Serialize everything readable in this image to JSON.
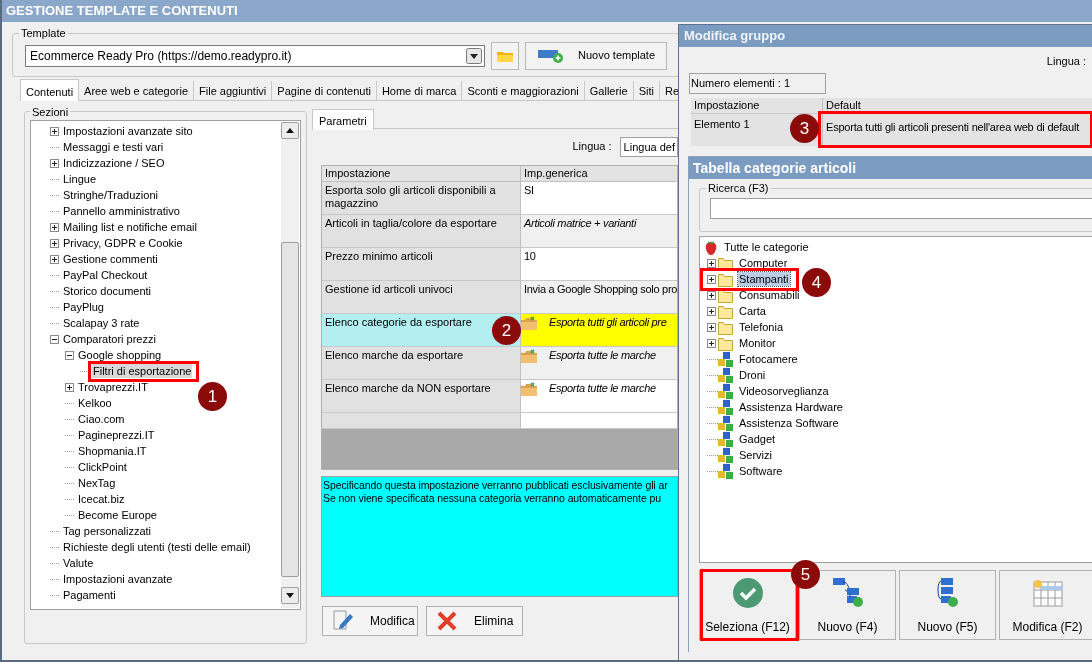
{
  "window": {
    "title": "GESTIONE TEMPLATE E CONTENUTI"
  },
  "template": {
    "label": "Template",
    "value": "Ecommerce Ready Pro (https://demo.readypro.it)",
    "new_button": "Nuovo template"
  },
  "tabs": [
    {
      "label": "Contenuti",
      "selected": true
    },
    {
      "label": "Aree web e categorie",
      "selected": false
    },
    {
      "label": "File aggiuntivi",
      "selected": false
    },
    {
      "label": "Pagine di contenuti",
      "selected": false
    },
    {
      "label": "Home di marca",
      "selected": false
    },
    {
      "label": "Sconti e maggiorazioni",
      "selected": false
    },
    {
      "label": "Gallerie",
      "selected": false
    },
    {
      "label": "Siti",
      "selected": false
    },
    {
      "label": "Re",
      "selected": false
    }
  ],
  "sections": {
    "label": "Sezioni",
    "tree": [
      {
        "label": "Impostazioni avanzate sito",
        "expanded": false,
        "selected": false
      },
      {
        "label": "Messaggi e testi vari",
        "selected": false
      },
      {
        "label": "Indicizzazione / SEO",
        "expanded": false,
        "selected": false
      },
      {
        "label": "Lingue",
        "selected": false
      },
      {
        "label": "Stringhe/Traduzioni",
        "selected": false
      },
      {
        "label": "Pannello amministrativo",
        "selected": false
      },
      {
        "label": "Mailing list e notifiche email",
        "expanded": false,
        "selected": false
      },
      {
        "label": "Privacy, GDPR e Cookie",
        "expanded": false,
        "selected": false
      },
      {
        "label": "Gestione commenti",
        "expanded": false,
        "selected": false
      },
      {
        "label": "PayPal Checkout",
        "selected": false
      },
      {
        "label": "Storico documenti",
        "selected": false
      },
      {
        "label": "PayPlug",
        "selected": false
      },
      {
        "label": "Scalapay 3 rate",
        "selected": false
      },
      {
        "label": "Comparatori prezzi",
        "expanded": true,
        "selected": false,
        "children": [
          {
            "label": "Google shopping",
            "expanded": true,
            "selected": false,
            "children": [
              {
                "label": "Filtri di esportazione",
                "selected": true
              }
            ]
          },
          {
            "label": "Trovaprezzi.IT",
            "expanded": false,
            "selected": false
          },
          {
            "label": "Kelkoo",
            "selected": false
          },
          {
            "label": "Ciao.com",
            "selected": false
          },
          {
            "label": "Pagineprezzi.IT",
            "selected": false
          },
          {
            "label": "Shopmania.IT",
            "selected": false
          },
          {
            "label": "ClickPoint",
            "selected": false
          },
          {
            "label": "NexTag",
            "selected": false
          },
          {
            "label": "Icecat.biz",
            "selected": false
          },
          {
            "label": "Become Europe",
            "selected": false
          }
        ]
      },
      {
        "label": "Tag personalizzati",
        "selected": false
      },
      {
        "label": "Richieste degli utenti (testi delle email)",
        "selected": false
      },
      {
        "label": "Valute",
        "selected": false
      },
      {
        "label": "Impostazioni avanzate",
        "selected": false
      },
      {
        "label": "Pagamenti",
        "selected": false
      }
    ]
  },
  "parameters": {
    "tab": "Parametri",
    "language_label": "Lingua :",
    "language_value": "Lingua def",
    "columns": [
      "Impostazione",
      "Imp.generica"
    ],
    "rows": [
      {
        "setting": "Esporta solo gli articoli disponibili a magazzino",
        "value": "SI",
        "kind": "text",
        "selected": false
      },
      {
        "setting": "Articoli in taglia/colore da esportare",
        "value": "Articoli matrice + varianti",
        "kind": "choice",
        "selected": false
      },
      {
        "setting": "Prezzo minimo articoli",
        "value": "10",
        "kind": "text",
        "selected": false
      },
      {
        "setting": "Gestione id articoli univoci",
        "value": "Invia a Google Shopping solo pro",
        "kind": "text",
        "selected": false
      },
      {
        "setting": "Elenco categorie da esportare",
        "value": "Esporta tutti gli articoli pre",
        "kind": "list",
        "selected": true
      },
      {
        "setting": "Elenco marche da esportare",
        "value": "Esporta tutte le marche",
        "kind": "list",
        "selected": false
      },
      {
        "setting": "Elenco marche da NON esportare",
        "value": "Esporta tutte le marche",
        "kind": "list",
        "selected": false
      }
    ],
    "description": [
      "Specificando questa impostazione verranno pubblicati esclusivamente gli ar",
      "Se non viene specificata nessuna categoria verranno automaticamente pu"
    ],
    "buttons": [
      "Modifica",
      "Elimina"
    ]
  },
  "group_dialog": {
    "title": "Modifica gruppo",
    "language_label": "Lingua :",
    "count": "Numero elementi : 1",
    "columns": [
      "Impostazione",
      "Default"
    ],
    "rows": [
      {
        "setting": "Elemento 1",
        "value": "Esporta tutti gli articoli presenti nell'area web di default"
      }
    ]
  },
  "category_dialog": {
    "title": "Tabella categorie articoli",
    "search_label": "Ricerca (F3)",
    "tree": {
      "label": "Tutte le categorie",
      "selected": false,
      "children": [
        {
          "label": "Computer",
          "kind": "folder",
          "selected": false
        },
        {
          "label": "Stampanti",
          "kind": "folder",
          "selected": true
        },
        {
          "label": "Consumabili",
          "kind": "folder",
          "selected": false
        },
        {
          "label": "Carta",
          "kind": "folder",
          "selected": false
        },
        {
          "label": "Telefonia",
          "kind": "folder",
          "selected": false
        },
        {
          "label": "Monitor",
          "kind": "folder",
          "selected": false
        },
        {
          "label": "Fotocamere",
          "kind": "group",
          "selected": false
        },
        {
          "label": "Droni",
          "kind": "group",
          "selected": false
        },
        {
          "label": "Videosorveglianza",
          "kind": "group",
          "selected": false
        },
        {
          "label": "Assistenza Hardware",
          "kind": "group",
          "selected": false
        },
        {
          "label": "Assistenza Software",
          "kind": "group",
          "selected": false
        },
        {
          "label": "Gadget",
          "kind": "group",
          "selected": false
        },
        {
          "label": "Servizi",
          "kind": "group",
          "selected": false
        },
        {
          "label": "Software",
          "kind": "group",
          "selected": false
        }
      ]
    },
    "buttons": [
      {
        "label": "Seleziona (F12)",
        "kind": "select"
      },
      {
        "label": "Nuovo (F4)",
        "kind": "new-child"
      },
      {
        "label": "Nuovo (F5)",
        "kind": "new-sibling"
      },
      {
        "label": "Modifica (F2)",
        "kind": "edit"
      }
    ]
  },
  "callouts": [
    "1",
    "2",
    "3",
    "4",
    "5"
  ]
}
